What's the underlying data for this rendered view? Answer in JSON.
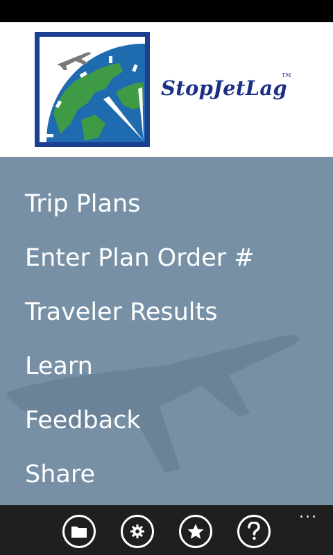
{
  "header": {
    "brand_name": "StopJetLag",
    "trademark": "TM"
  },
  "menu": {
    "items": [
      {
        "label": "Trip Plans"
      },
      {
        "label": "Enter Plan Order #"
      },
      {
        "label": "Traveler Results"
      },
      {
        "label": "Learn"
      },
      {
        "label": "Feedback"
      },
      {
        "label": "Share"
      }
    ]
  },
  "app_bar": {
    "buttons": [
      {
        "icon": "folder-icon"
      },
      {
        "icon": "gear-icon"
      },
      {
        "icon": "star-icon"
      },
      {
        "icon": "help-icon"
      }
    ],
    "more": "..."
  },
  "colors": {
    "menu_background": "#7790a5",
    "brand_blue": "#1c2f86",
    "app_bar": "#1f1f1f"
  }
}
